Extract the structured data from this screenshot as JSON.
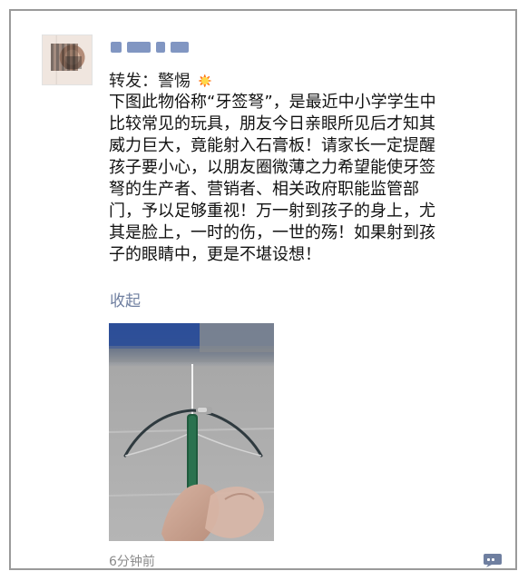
{
  "post": {
    "author": {
      "display_name": "",
      "avatar_icon": "blurred-avatar-icon"
    },
    "repost_label": "转发：警惕",
    "emoji": "collision-emoji-icon",
    "text": "下图此物俗称“牙签弩”，是最近中小学学生中\n比较常见的玩具，朋友今日亲眼所见后才知其\n威力巨大，竟能射入石膏板！请家长一定提醒\n孩子要小心，以朋友圈微薄之力希望能使牙签\n弩的生产者、营销者、相关政府职能监管部\n门，予以足够重视！万一射到孩子的身上，尤\n其是脸上，一时的伤，一世的殇！如果射到孩\n子的眼睛中，更是不堪设想！",
    "collapse_label": "收起",
    "time_ago": "6分钟前",
    "comment_icon": "comment-icon"
  },
  "colors": {
    "link": "#6f7fa0",
    "meta": "#8b8b8b",
    "text": "#111111",
    "frame": "#9a9a9a"
  }
}
